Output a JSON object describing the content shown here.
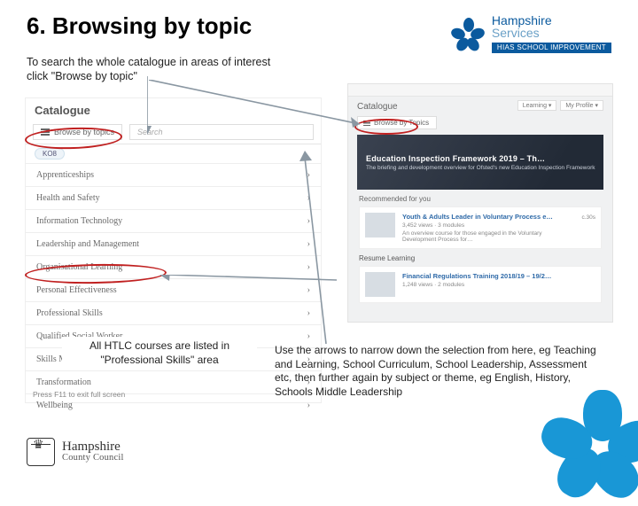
{
  "title": "6. Browsing by topic",
  "intro": "To search the whole catalogue in areas of interest click \"Browse by topic\"",
  "logo_top": {
    "l1": "Hampshire",
    "l2": "Services",
    "badge": "HIAS SCHOOL IMPROVEMENT"
  },
  "left_shot": {
    "heading": "Catalogue",
    "browse_label": "Browse by topics",
    "search_placeholder": "Search",
    "tag": "KO8",
    "footer": "Press F11 to exit full screen",
    "topics": [
      "Apprenticeships",
      "Health and Safety",
      "Information Technology",
      "Leadership and Management",
      "Organisational Learning",
      "Personal Effectiveness",
      "Professional Skills",
      "Qualified Social Worker",
      "Skills Matters",
      "Transformation",
      "Wellbeing"
    ]
  },
  "right_shot": {
    "heading": "Catalogue",
    "browse_label": "Browse by Topics",
    "badge1": "Learning ▾",
    "badge2": "My Profile ▾",
    "hero_title": "Education Inspection Framework 2019 – Th…",
    "hero_sub": "The briefing and development overview for Ofsted's new Education Inspection Framework",
    "sub_heading": "Recommended for you",
    "rec1_title": "Youth & Adults Leader in Voluntary Process e…",
    "rec1_meta": "3,452 views · 3 modules",
    "rec1_desc": "An overview course for those engaged in the Voluntary Development Process for…",
    "rec1_minutes": "c.30s",
    "sub_heading2": "Resume Learning",
    "rec2_title": "Financial Regulations Training 2018/19 – 19/2…",
    "rec2_meta": "1,248 views · 2 modules"
  },
  "caption_left": "All HTLC courses are listed in \"Professional Skills\" area",
  "caption_right": "Use the arrows to narrow down the selection from here, eg Teaching and Learning, School Curriculum, School Leadership, Assessment etc, then further again by subject or theme, eg English, History, Schools Middle Leadership",
  "logo_bl": {
    "b1": "Hampshire",
    "b2": "County Council"
  }
}
